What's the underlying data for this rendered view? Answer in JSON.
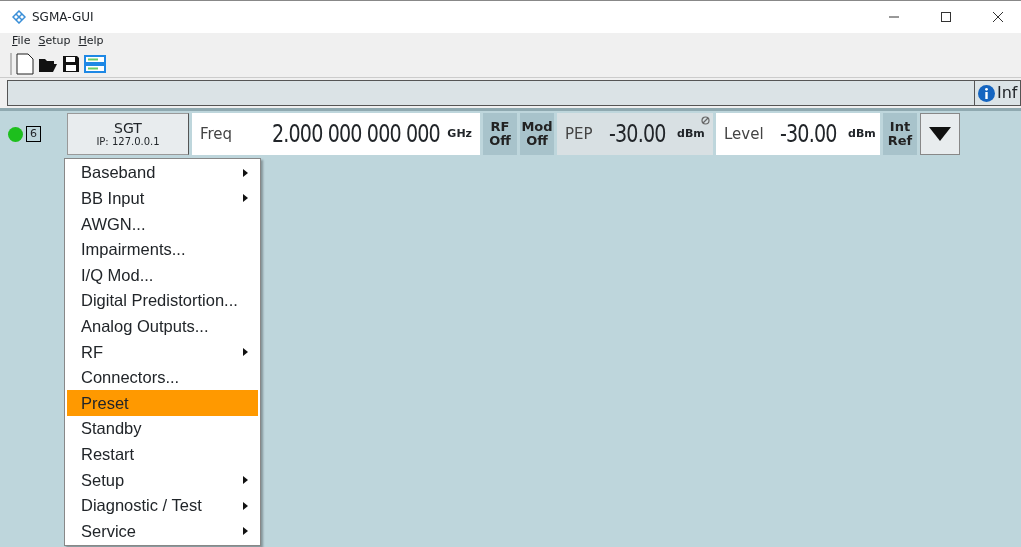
{
  "window": {
    "title": "SGMA-GUI"
  },
  "menubar": [
    {
      "label": "File"
    },
    {
      "label": "Setup"
    },
    {
      "label": "Help"
    }
  ],
  "info_button": {
    "label": "Inf"
  },
  "instrument": {
    "connected": true,
    "count": "6",
    "name": "SGT",
    "ip": "IP: 127.0.0.1"
  },
  "freq": {
    "label": "Freq",
    "value": "2.000 000 000 000",
    "unit": "GHz"
  },
  "rf_button": {
    "label": "RF",
    "state": "Off"
  },
  "mod_button": {
    "label": "Mod",
    "state": "Off"
  },
  "pep": {
    "label": "PEP",
    "value": "-30.00",
    "unit": "dBm"
  },
  "level": {
    "label": "Level",
    "value": "-30.00",
    "unit": "dBm"
  },
  "ref_button": {
    "label": "Int",
    "state": "Ref"
  },
  "context_menu": [
    {
      "label": "Baseband",
      "submenu": true,
      "selected": false
    },
    {
      "label": "BB Input",
      "submenu": true,
      "selected": false
    },
    {
      "label": "AWGN...",
      "submenu": false,
      "selected": false
    },
    {
      "label": "Impairments...",
      "submenu": false,
      "selected": false
    },
    {
      "label": "I/Q Mod...",
      "submenu": false,
      "selected": false
    },
    {
      "label": "Digital Predistortion...",
      "submenu": false,
      "selected": false
    },
    {
      "label": "Analog Outputs...",
      "submenu": false,
      "selected": false
    },
    {
      "label": "RF",
      "submenu": true,
      "selected": false
    },
    {
      "label": "Connectors...",
      "submenu": false,
      "selected": false
    },
    {
      "label": "Preset",
      "submenu": false,
      "selected": true
    },
    {
      "label": "Standby",
      "submenu": false,
      "selected": false
    },
    {
      "label": "Restart",
      "submenu": false,
      "selected": false
    },
    {
      "label": "Setup",
      "submenu": true,
      "selected": false
    },
    {
      "label": "Diagnostic / Test",
      "submenu": true,
      "selected": false
    },
    {
      "label": "Service",
      "submenu": true,
      "selected": false
    }
  ]
}
